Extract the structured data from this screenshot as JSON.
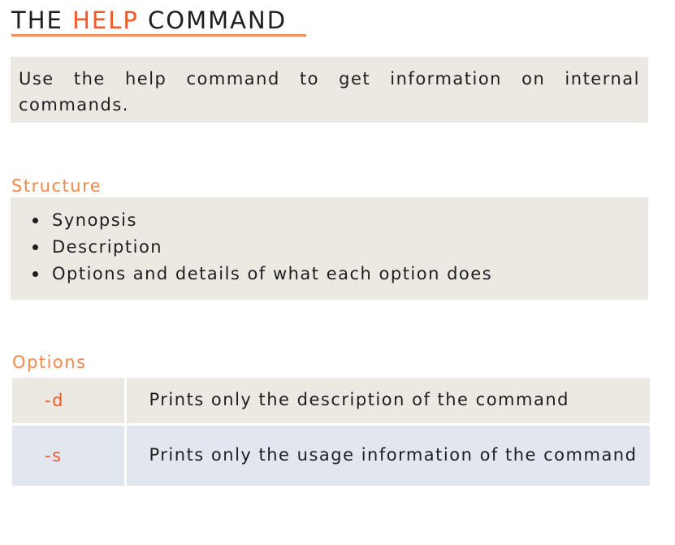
{
  "title": {
    "part1": "THE ",
    "accent": "HELP",
    "part2": " COMMAND"
  },
  "intro": {
    "text": "Use the help command to get information on internal commands."
  },
  "structure": {
    "heading": "Structure",
    "items": [
      "Synopsis",
      "Description",
      "Options and details of what each option does"
    ]
  },
  "options": {
    "heading": "Options",
    "rows": [
      {
        "flag": "-d",
        "description": "Prints only the description of the command"
      },
      {
        "flag": "-s",
        "description": "Prints only the usage information of the command"
      }
    ]
  },
  "colors": {
    "accent": "#f15a29",
    "heading": "#f4874b",
    "box_beige": "#ece9e2",
    "box_blue": "#e1e6ef"
  }
}
